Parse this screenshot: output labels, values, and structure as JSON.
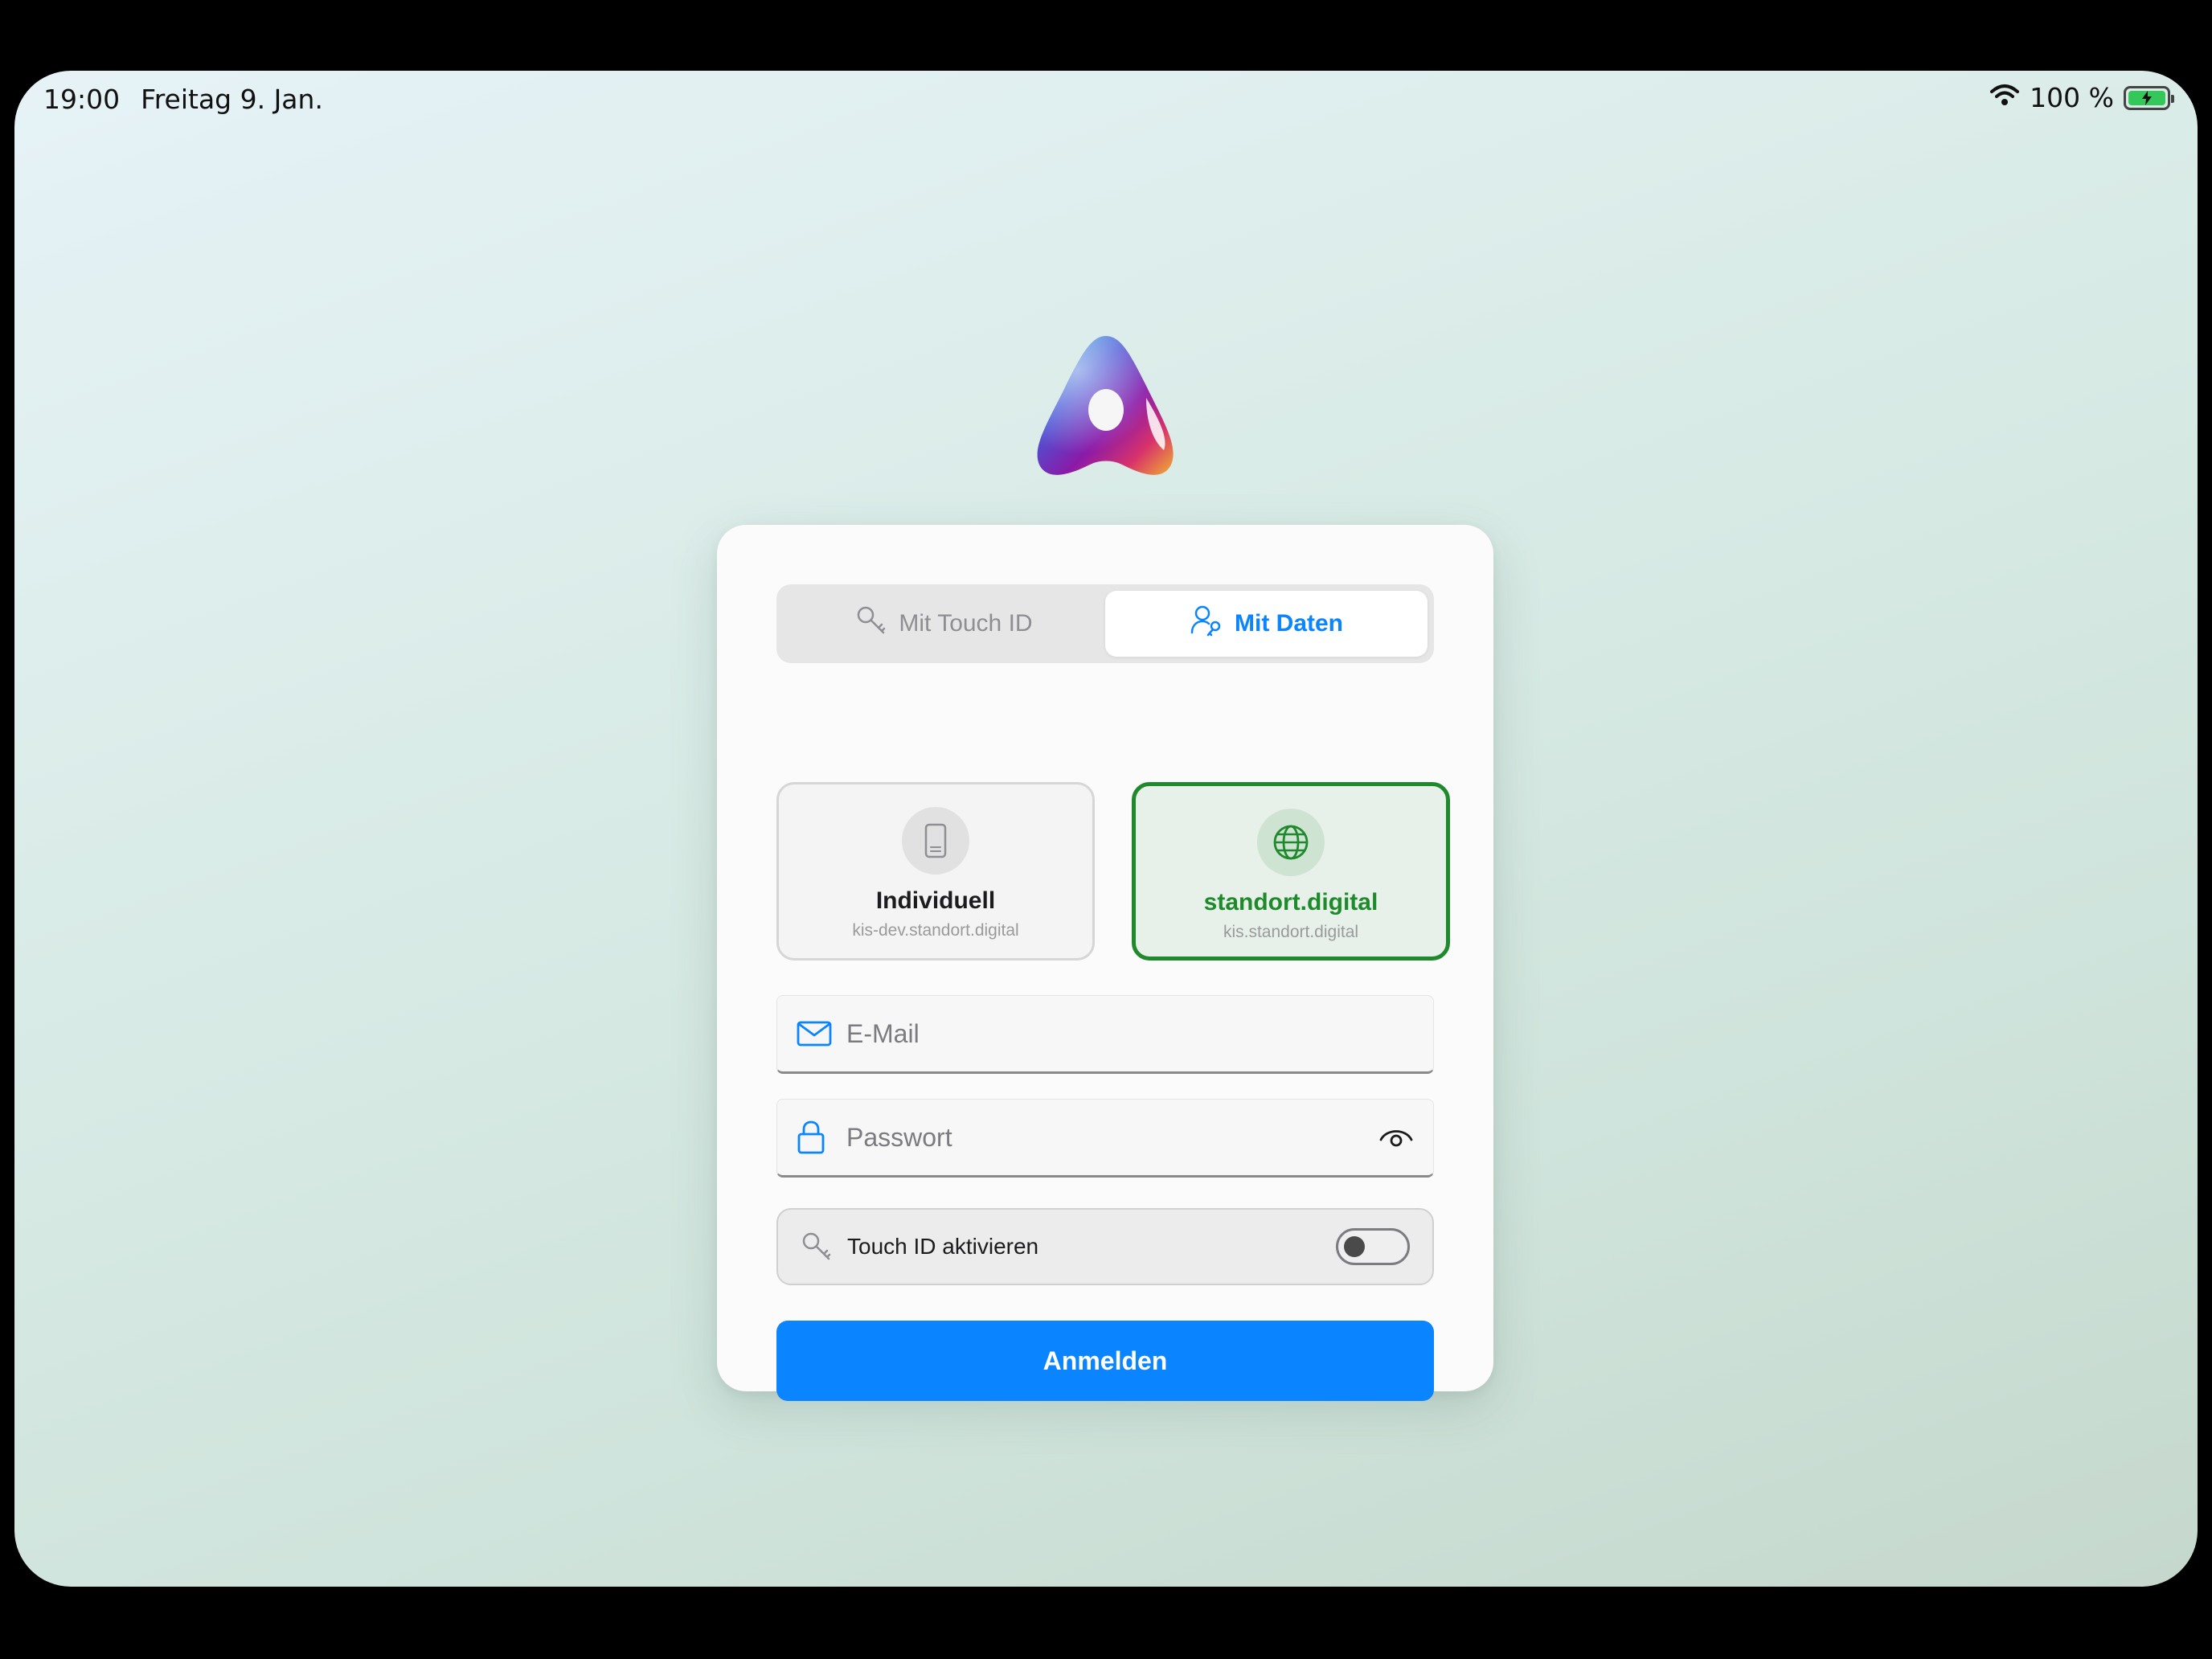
{
  "status_bar": {
    "time": "19:00",
    "date": "Freitag 9. Jan.",
    "battery": "100 %",
    "wifi_icon": "wifi-icon",
    "battery_icon": "battery-charging-icon"
  },
  "app": {
    "logo_icon": "triangle-logo-icon"
  },
  "login_mode": {
    "tabs": [
      {
        "label": "Mit Touch ID",
        "icon": "key-icon",
        "selected": false
      },
      {
        "label": "Mit Daten",
        "icon": "user-key-icon",
        "selected": true
      }
    ]
  },
  "environments": [
    {
      "title": "Individuell",
      "subtitle": "kis-dev.standort.digital",
      "icon": "phone-icon",
      "selected": false
    },
    {
      "title": "standort.digital",
      "subtitle": "kis.standort.digital",
      "icon": "globe-icon",
      "selected": true
    }
  ],
  "form": {
    "email": {
      "placeholder": "E-Mail",
      "value": "",
      "icon": "mail-icon"
    },
    "password": {
      "placeholder": "Passwort",
      "value": "",
      "icon": "lock-icon",
      "toggle_icon": "eye-icon"
    },
    "touch_id": {
      "label": "Touch ID aktivieren",
      "icon": "key-icon",
      "enabled": false
    },
    "submit_label": "Anmelden"
  },
  "colors": {
    "accent": "#0a84ff",
    "selected_env": "#1f8a2c",
    "battery": "#34c759"
  }
}
